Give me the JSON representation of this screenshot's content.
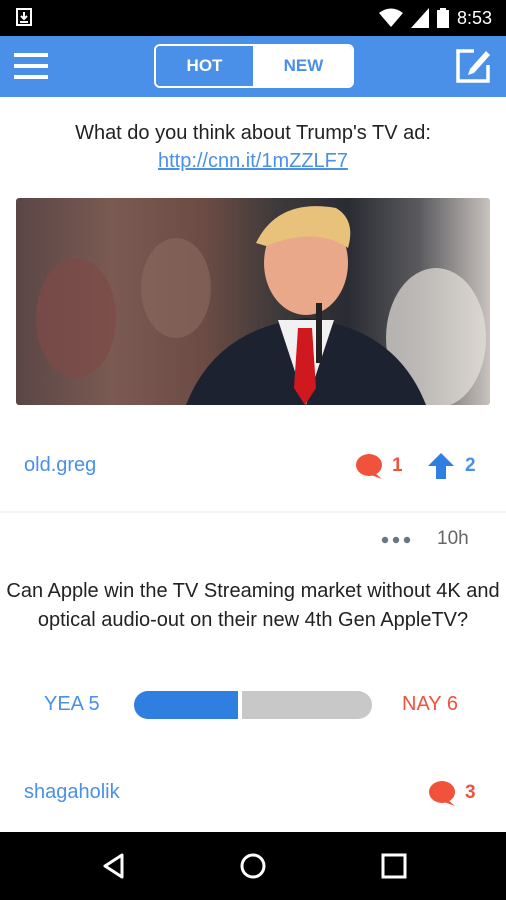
{
  "status_bar": {
    "time": "8:53"
  },
  "header": {
    "tabs": [
      {
        "label": "HOT"
      },
      {
        "label": "NEW"
      }
    ],
    "active_tab": "NEW",
    "menu_icon": "hamburger-menu-icon",
    "compose_icon": "compose-edit-icon"
  },
  "posts": [
    {
      "question_text": "What do you think about Trump's TV ad:",
      "link": "http://cnn.it/1mZZLF7",
      "author": "old.greg",
      "comments": "1",
      "upvotes": "2"
    },
    {
      "age": "10h",
      "question_text": "Can Apple win the TV Streaming market without 4K and optical audio-out on their new 4th Gen AppleTV?",
      "yea_label": "YEA 5",
      "nay_label": "NAY 6",
      "yea_count": 5,
      "nay_count": 6,
      "author": "shagaholik",
      "comments": "3"
    }
  ],
  "colors": {
    "accent": "#4a90e8",
    "comment_red": "#f0523c",
    "yea_blue": "#2f7fe0",
    "nay_gray": "#c8c8c8"
  }
}
